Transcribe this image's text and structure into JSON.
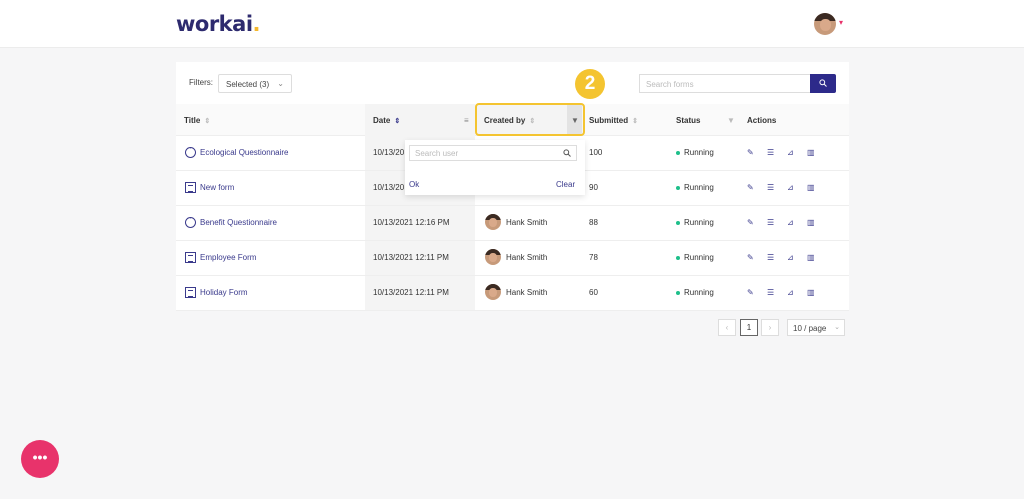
{
  "header": {
    "logo_text": "workai",
    "logo_dot": "."
  },
  "filters": {
    "label": "Filters:",
    "selected": "Selected (3)"
  },
  "search": {
    "placeholder": "Search forms"
  },
  "step_badge": "2",
  "columns": {
    "title": "Title",
    "date": "Date",
    "created_by": "Created by",
    "submitted": "Submitted",
    "status": "Status",
    "actions": "Actions"
  },
  "dropdown": {
    "search_placeholder": "Search user",
    "ok": "Ok",
    "clear": "Clear"
  },
  "rows": [
    {
      "title": "Ecological Questionnaire",
      "icon": "circle-dots-icon",
      "date": "10/13/20",
      "created_by": "",
      "submitted": "100",
      "status": "Running"
    },
    {
      "title": "New form",
      "icon": "document-icon",
      "date": "10/13/20",
      "created_by": "",
      "submitted": "90",
      "status": "Running"
    },
    {
      "title": "Benefit Questionnaire",
      "icon": "circle-dots-icon",
      "date": "10/13/2021 12:16 PM",
      "created_by": "Hank Smith",
      "submitted": "88",
      "status": "Running"
    },
    {
      "title": "Employee Form",
      "icon": "document-icon",
      "date": "10/13/2021 12:11 PM",
      "created_by": "Hank Smith",
      "submitted": "78",
      "status": "Running"
    },
    {
      "title": "Holiday Form",
      "icon": "document-icon",
      "date": "10/13/2021 12:11 PM",
      "created_by": "Hank Smith",
      "submitted": "60",
      "status": "Running"
    }
  ],
  "pagination": {
    "prev": "‹",
    "current": "1",
    "next": "›",
    "page_size": "10 / page"
  },
  "fab": {
    "label": "•••"
  },
  "colors": {
    "brand": "#2d2a6e",
    "accent": "#f4c430",
    "fab": "#e8336b",
    "status_running": "#1dbf8a"
  }
}
